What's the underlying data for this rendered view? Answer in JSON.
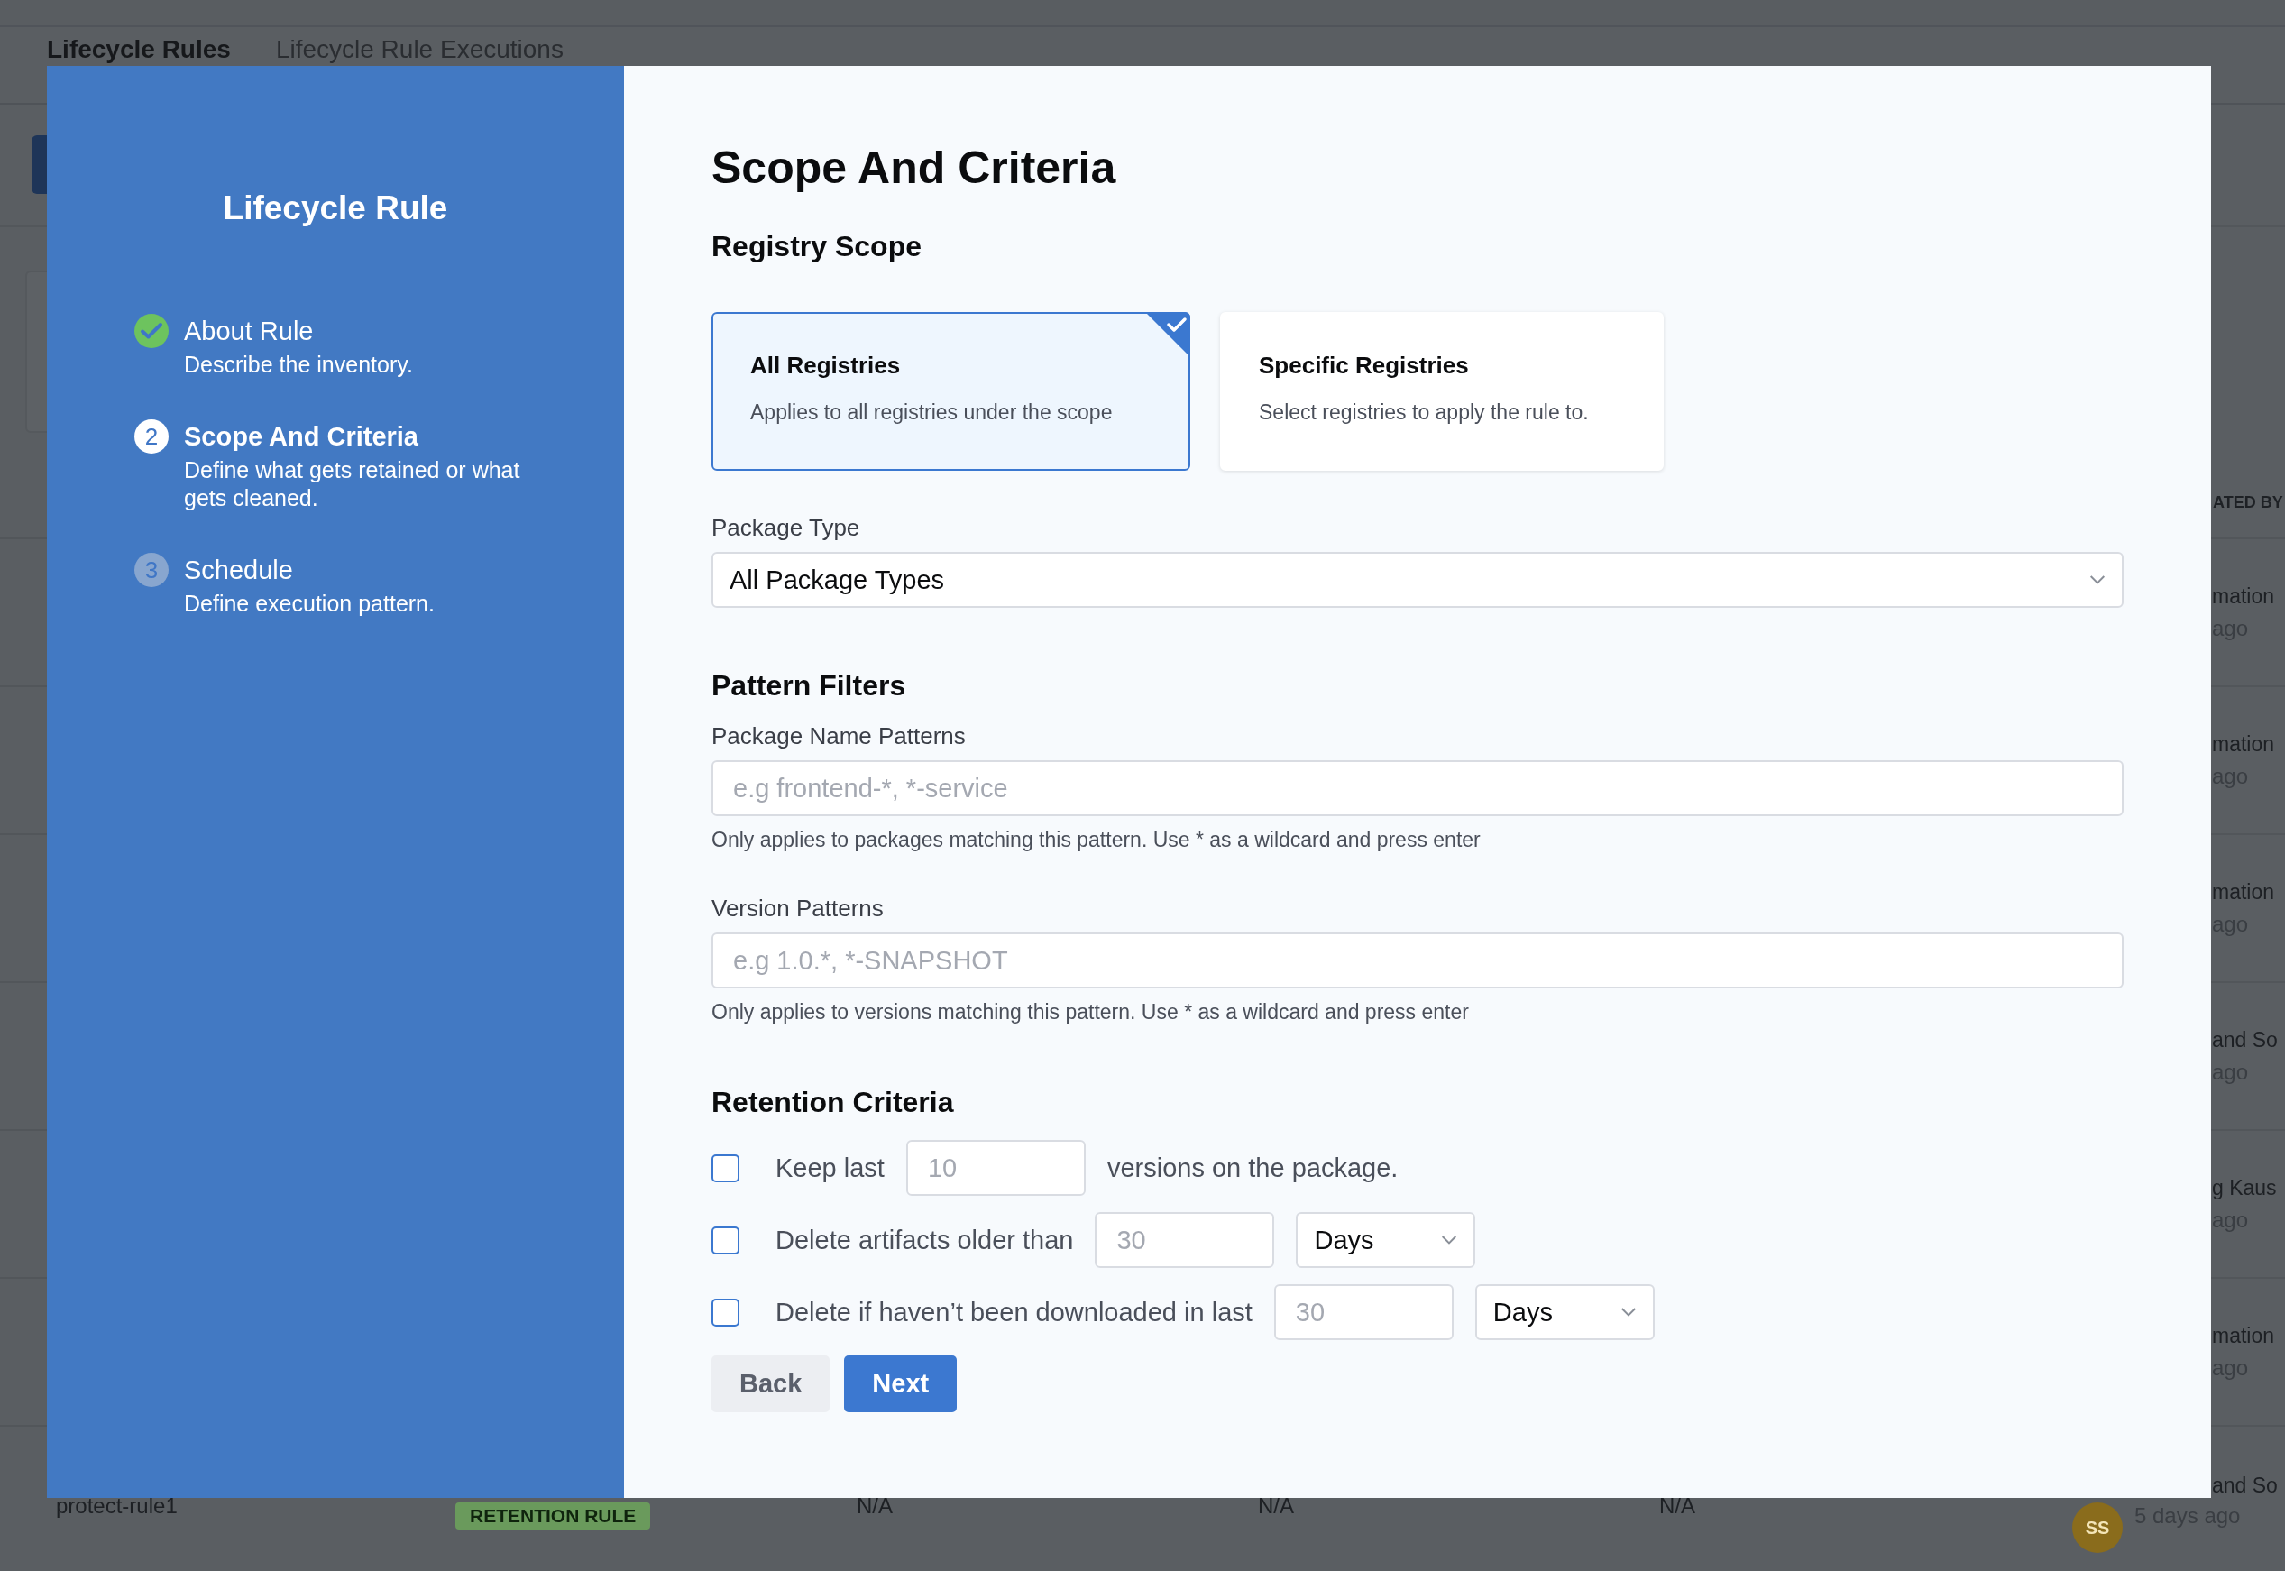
{
  "background": {
    "tabs": [
      {
        "label": "Lifecycle Rules",
        "selected": true
      },
      {
        "label": "Lifecycle Rule Executions",
        "selected": false
      }
    ],
    "table": {
      "column_6_header": "ATED BY",
      "rows": [
        {
          "created_by": "mation",
          "time": "ago"
        },
        {
          "created_by": "mation",
          "time": "ago"
        },
        {
          "created_by": "mation",
          "time": "ago"
        },
        {
          "created_by": "and So",
          "time": "ago"
        },
        {
          "created_by": "g Kaus",
          "time": "ago"
        },
        {
          "created_by": "mation",
          "time": "ago"
        }
      ],
      "last_row": {
        "name": "protect-rule1",
        "tag": "RETENTION RULE",
        "column_3": "N/A",
        "column_4": "N/A",
        "column_5": "N/A",
        "avatar": "SS",
        "created_by": "and So",
        "time": "5 days ago"
      }
    }
  },
  "modal": {
    "title": "Lifecycle Rule",
    "steps": [
      {
        "completed": true,
        "selected": false,
        "title": "About Rule",
        "description": "Describe the inventory."
      },
      {
        "completed": false,
        "selected": true,
        "number": "2",
        "title": "Scope And Criteria",
        "description": "Define what gets retained or what gets cleaned."
      },
      {
        "completed": false,
        "selected": false,
        "number": "3",
        "title": "Schedule",
        "description": "Define execution pattern."
      }
    ],
    "heading": "Scope And Criteria",
    "registry_scope": {
      "title": "Registry Scope",
      "options": [
        {
          "title": "All Registries",
          "description": "Applies to all registries under the scope",
          "selected": true
        },
        {
          "title": "Specific Registries",
          "description": "Select registries to apply the rule to.",
          "selected": false
        }
      ]
    },
    "package_type": {
      "label": "Package Type",
      "value": "All Package Types"
    },
    "pattern_filters": {
      "title": "Pattern Filters",
      "fields": [
        {
          "label": "Package Name Patterns",
          "placeholder": "e.g frontend-*, *-service",
          "help": "Only applies to packages matching this pattern. Use * as a wildcard and press enter"
        },
        {
          "label": "Version Patterns",
          "placeholder": "e.g 1.0.*, *-SNAPSHOT",
          "help": "Only applies to versions matching this pattern. Use * as a wildcard and press enter"
        }
      ]
    },
    "retention_criteria": {
      "title": "Retention Criteria",
      "rows": [
        {
          "checked": false,
          "label": "Keep last",
          "placeholder": "10",
          "suffix": "versions on the package."
        },
        {
          "checked": false,
          "label": "Delete artifacts older than",
          "placeholder": "30",
          "unit": "Days"
        },
        {
          "checked": false,
          "label": "Delete if haven’t been downloaded in last",
          "placeholder": "30",
          "unit": "Days"
        }
      ]
    },
    "buttons": [
      {
        "label": "Back",
        "kind": "secondary"
      },
      {
        "label": "Next",
        "kind": "primary"
      }
    ]
  }
}
